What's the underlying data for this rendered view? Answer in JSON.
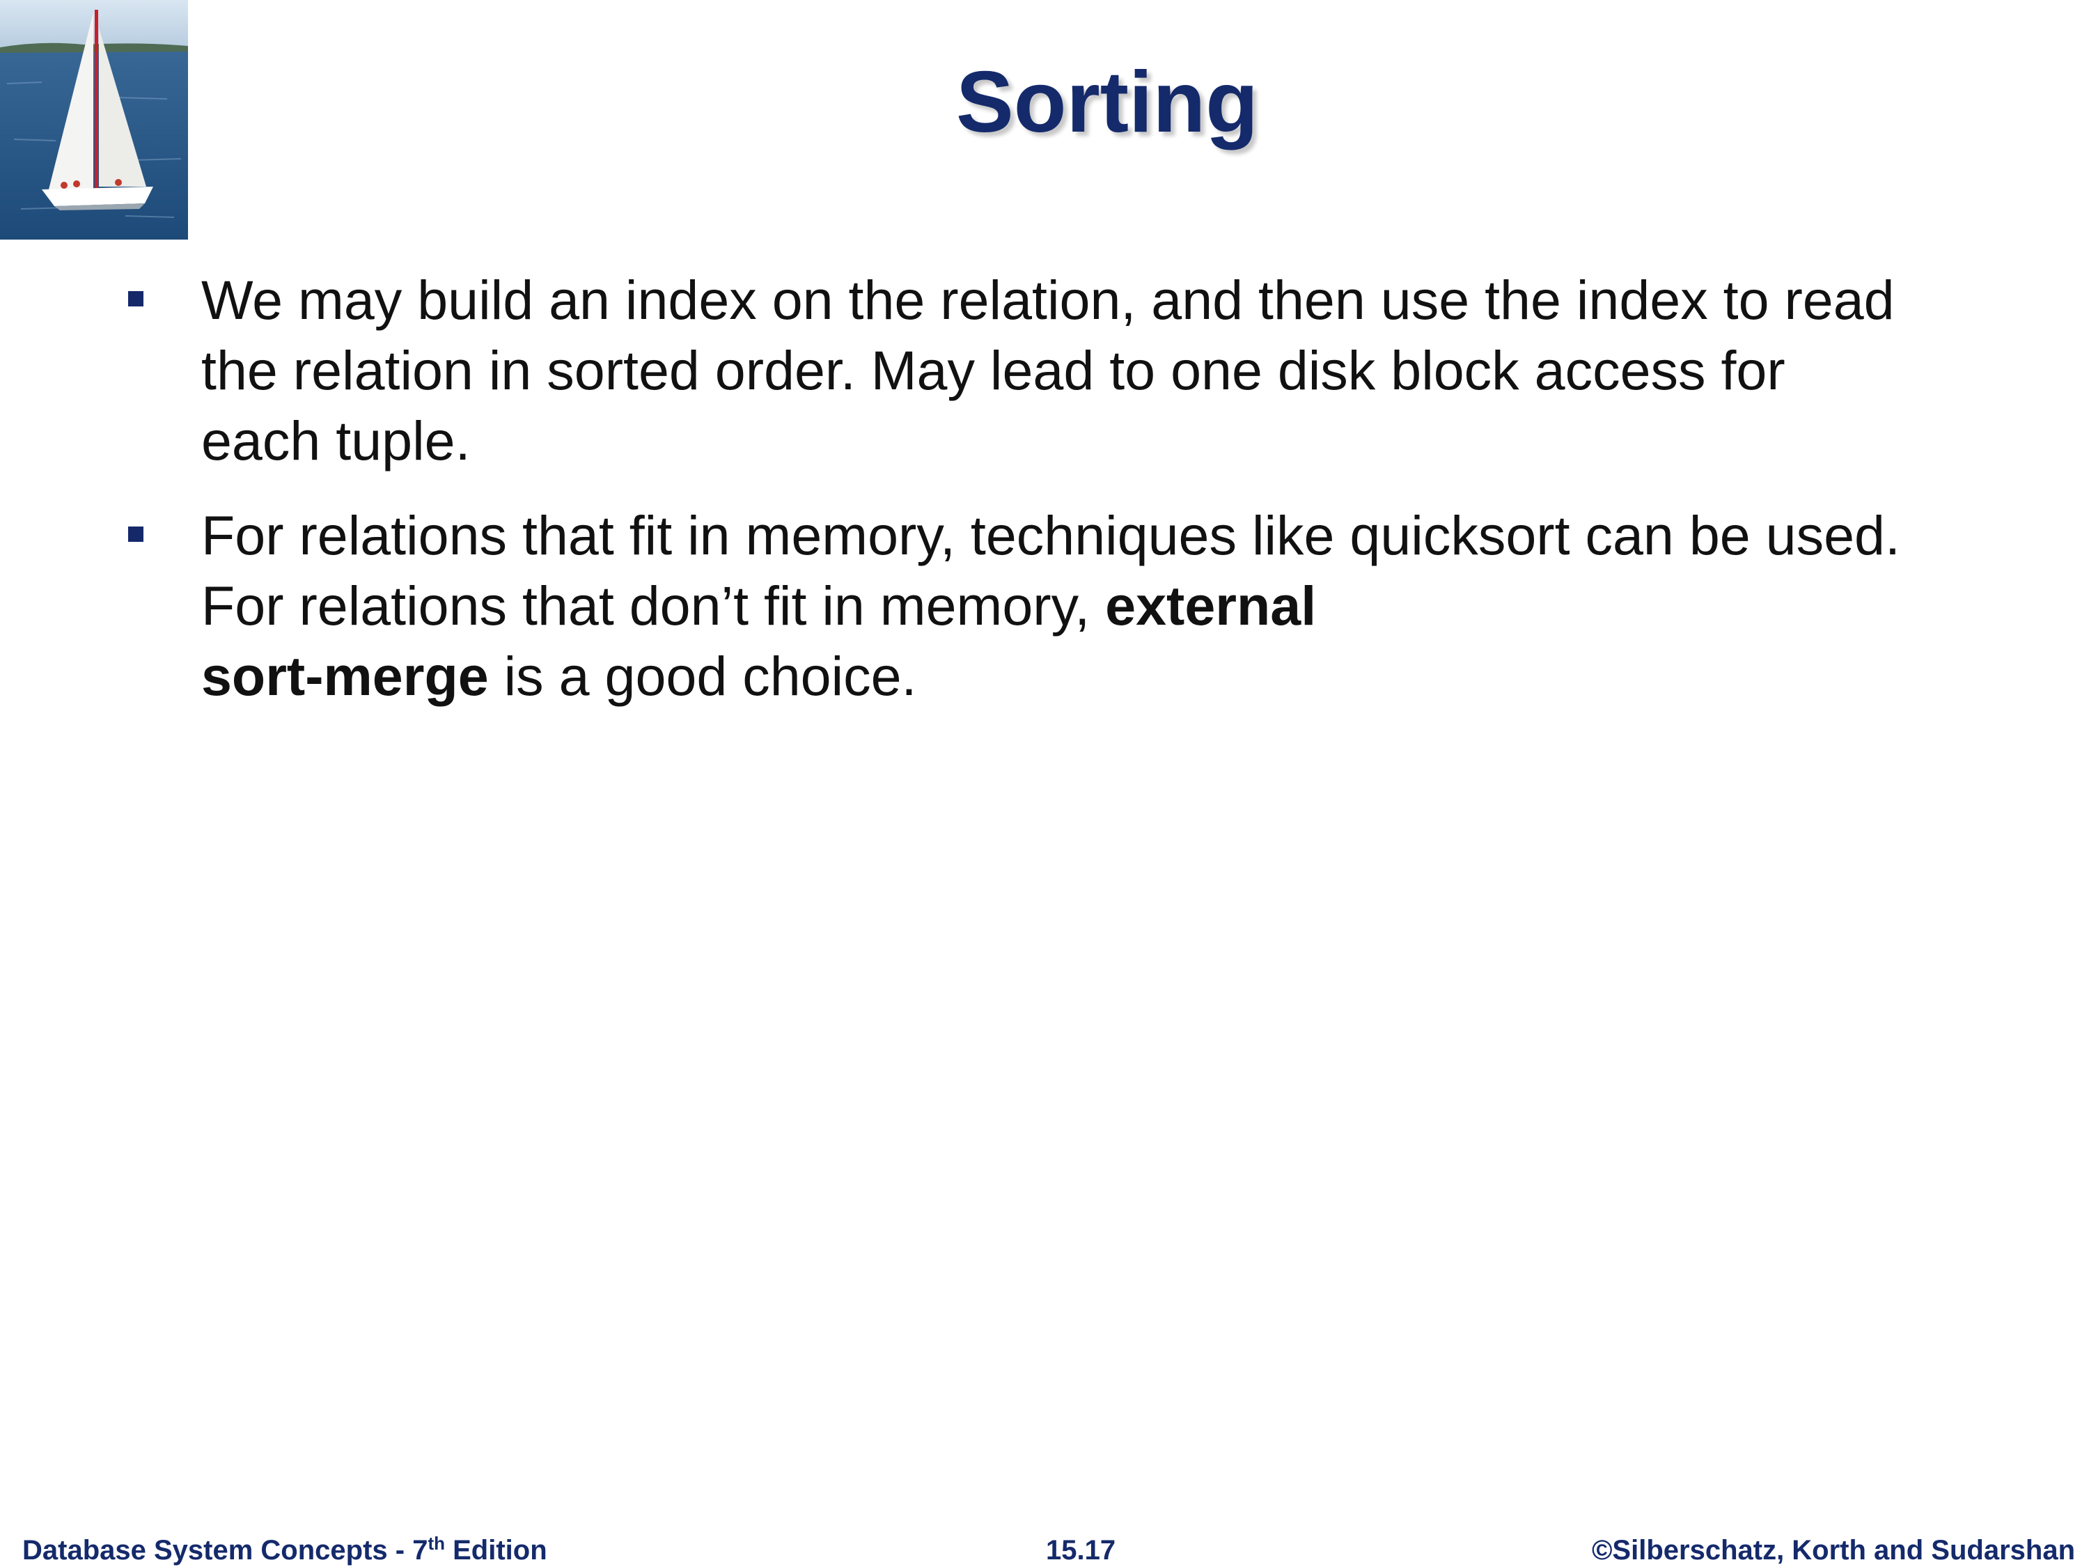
{
  "slide": {
    "title": "Sorting",
    "logo_image": "sailboat-on-sea-image",
    "bullets": [
      {
        "lines": [
          "We may build an index on the relation, and then use the index to read",
          "the relation in sorted order.  May lead to one disk block access for",
          "each tuple."
        ]
      },
      {
        "line1": "For relations that fit in memory, techniques like quicksort can be used.",
        "line2_text": "For relations that don’t fit in memory, ",
        "line2_bold": "external",
        "line3_bold": "sort-merge",
        "line3_text": " is a good choice."
      }
    ],
    "bullet_color": "#14286a",
    "title_color": "#142a6b"
  },
  "footer": {
    "book": "Database System Concepts - 7",
    "book_sup": "th",
    "book_suffix": " Edition",
    "page": "15.17",
    "copyright": "©Silberschatz, Korth and Sudarshan"
  }
}
